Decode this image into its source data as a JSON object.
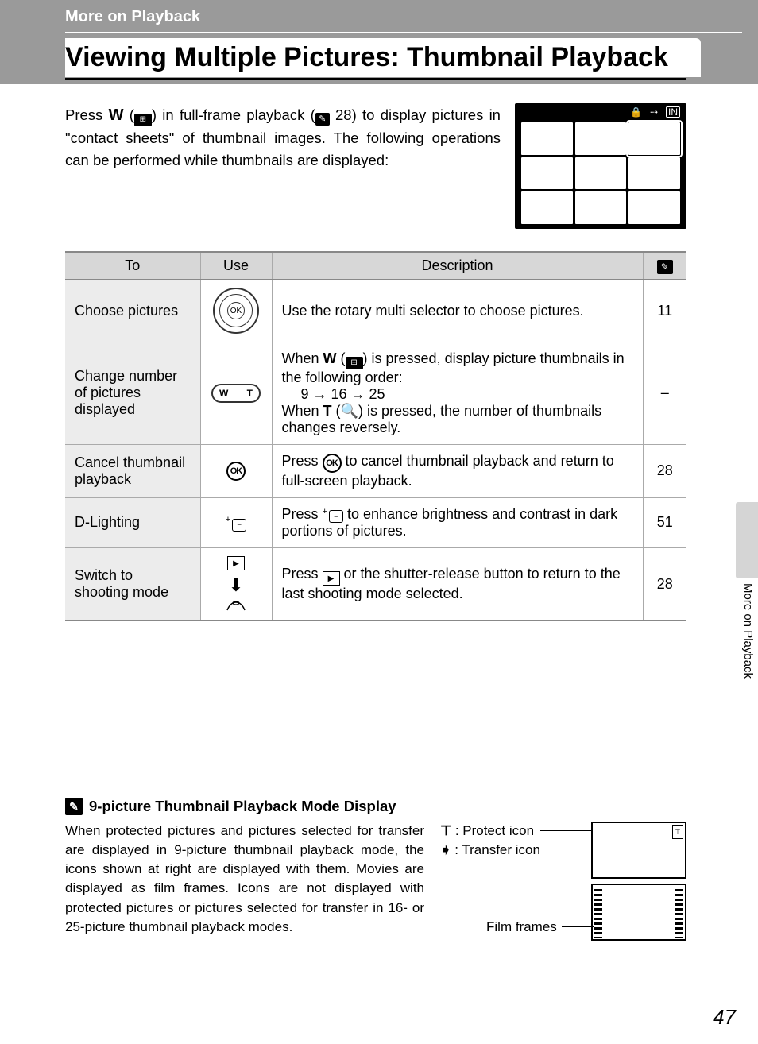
{
  "header": {
    "breadcrumb": "More on Playback",
    "title": "Viewing Multiple Pictures: Thumbnail Playback"
  },
  "intro": {
    "text_before": "Press ",
    "w_label": "W",
    "text_mid1": " (",
    "thumb_glyph": "⊞",
    "text_mid2": ") in full-frame playback (",
    "book_glyph": "✎",
    "ref_28": " 28) to display pictures in \"contact sheets\" of thumbnail images. The following operations can be performed while thumbnails are displayed:"
  },
  "table": {
    "headers": {
      "to": "To",
      "use": "Use",
      "desc": "Description",
      "ref": ""
    },
    "rows": [
      {
        "to": "Choose pictures",
        "use_type": "dial",
        "desc": "Use the rotary multi selector to choose pictures.",
        "ref": "11"
      },
      {
        "to": "Change number of pictures displayed",
        "use_type": "zoom",
        "desc_pre": "When ",
        "desc_w": "W",
        "desc_mid1": " (",
        "desc_glyph1": "⊞",
        "desc_mid2": ") is pressed, display picture thumbnails in the following order:",
        "seq": "9 → 16 → 25",
        "desc_t_pre": "When ",
        "desc_t": "T",
        "desc_t_mid": " (",
        "desc_glyph2": "🔍",
        "desc_t_post": ") is pressed, the number of thumbnails changes reversely.",
        "ref": "–"
      },
      {
        "to": "Cancel thumbnail playback",
        "use_type": "ok",
        "desc_pre": "Press ",
        "desc_post": " to cancel thumbnail playback and return to full-screen playback.",
        "ref": "28"
      },
      {
        "to": "D-Lighting",
        "use_type": "dlight",
        "desc_pre": "Press ",
        "desc_post": " to enhance brightness and contrast in dark portions of pictures.",
        "ref": "51"
      },
      {
        "to": "Switch to shooting mode",
        "use_type": "shutter",
        "desc_pre": "Press ",
        "desc_post": " or the shutter-release button to return to the last shooting mode selected.",
        "ref": "28"
      }
    ]
  },
  "side_label": "More on Playback",
  "section2": {
    "heading": "9-picture Thumbnail Playback Mode Display",
    "text": "When protected pictures and pictures selected for transfer are displayed in 9-picture thumbnail playback mode, the icons shown at right are displayed with them. Movies are displayed as film frames. Icons are not displayed with protected pictures or pictures selected for transfer in 16- or 25-picture thumbnail playback modes.",
    "legend_protect": ": Protect icon",
    "legend_transfer": ": Transfer icon",
    "film_label": "Film frames"
  },
  "page_number": "47",
  "icons": {
    "lock": "⊼",
    "transfer": "❯",
    "ok_small": "OK",
    "protect_glyph": "⊤",
    "transfer_glyph": "➧",
    "zoom_w": "W",
    "zoom_t": "T",
    "in_label": "IN"
  }
}
